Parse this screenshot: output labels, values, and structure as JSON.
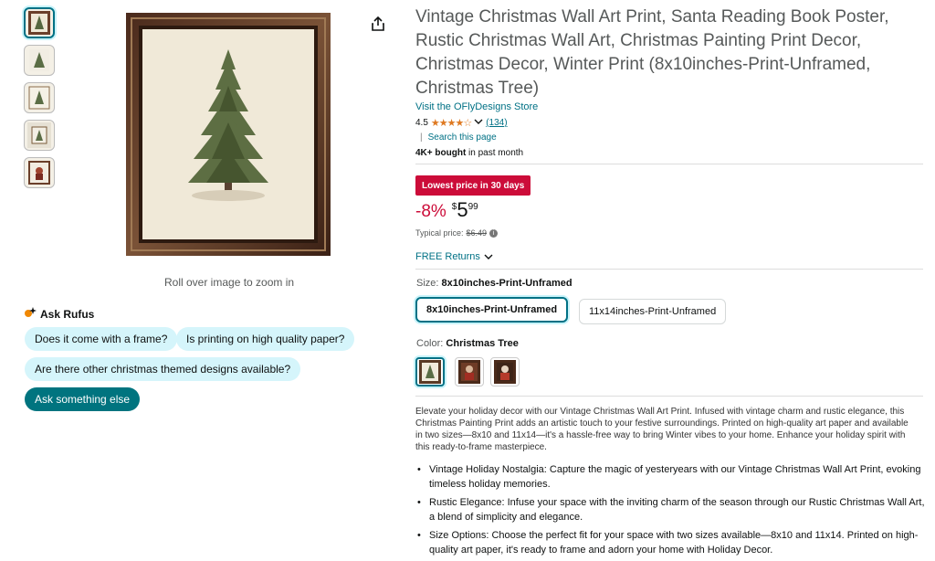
{
  "product": {
    "title": "Vintage Christmas Wall Art Print, Santa Reading Book Poster, Rustic Christmas Wall Art, Christmas Painting Print Decor, Christmas Decor, Winter Print (8x10inches-Print-Unframed, Christmas Tree)",
    "store_link": "Visit the OFlyDesigns Store",
    "rating_value": "4.5",
    "rating_count": "(134)",
    "search_page": "Search this page",
    "bought_bold": "4K+ bought",
    "bought_rest": " in past month"
  },
  "gallery": {
    "zoom_hint": "Roll over image to zoom in",
    "thumbnail_count": 5
  },
  "rufus": {
    "title": "Ask Rufus",
    "q1": "Does it come with a frame?",
    "q2": "Is printing on high quality paper?",
    "q3": "Are there other christmas themed designs available?",
    "ask": "Ask something else"
  },
  "pricing": {
    "badge": "Lowest price in 30 days",
    "discount": "-8%",
    "currency": "$",
    "whole": "5",
    "fraction": "99",
    "typical_label": "Typical price:",
    "typical_value": "$6.49",
    "returns": "FREE Returns"
  },
  "size": {
    "label": "Size:",
    "selected": "8x10inches-Print-Unframed",
    "options": [
      "8x10inches-Print-Unframed",
      "11x14inches-Print-Unframed"
    ]
  },
  "color": {
    "label": "Color:",
    "selected": "Christmas Tree"
  },
  "description": "Elevate your holiday decor with our Vintage Christmas Wall Art Print. Infused with vintage charm and rustic elegance, this Christmas Painting Print adds an artistic touch to your festive surroundings. Printed on high-quality art paper and available in two sizes—8x10 and 11x14—it's a hassle-free way to bring Winter vibes to your home. Enhance your holiday spirit with this ready-to-frame masterpiece.",
  "bullets": [
    "Vintage Holiday Nostalgia: Capture the magic of yesteryears with our Vintage Christmas Wall Art Print, evoking timeless holiday memories.",
    "Rustic Elegance: Infuse your space with the inviting charm of the season through our Rustic Christmas Wall Art, a blend of simplicity and elegance.",
    "Size Options: Choose the perfect fit for your space with two sizes available—8x10 and 11x14. Printed on high-quality art paper, it's ready to frame and adorn your home with Holiday Decor."
  ],
  "colors": {
    "link": "#007185",
    "deal": "#cc0c39",
    "star": "#de7921",
    "chip": "#d5f5fb",
    "chip_dark": "#00747f"
  }
}
